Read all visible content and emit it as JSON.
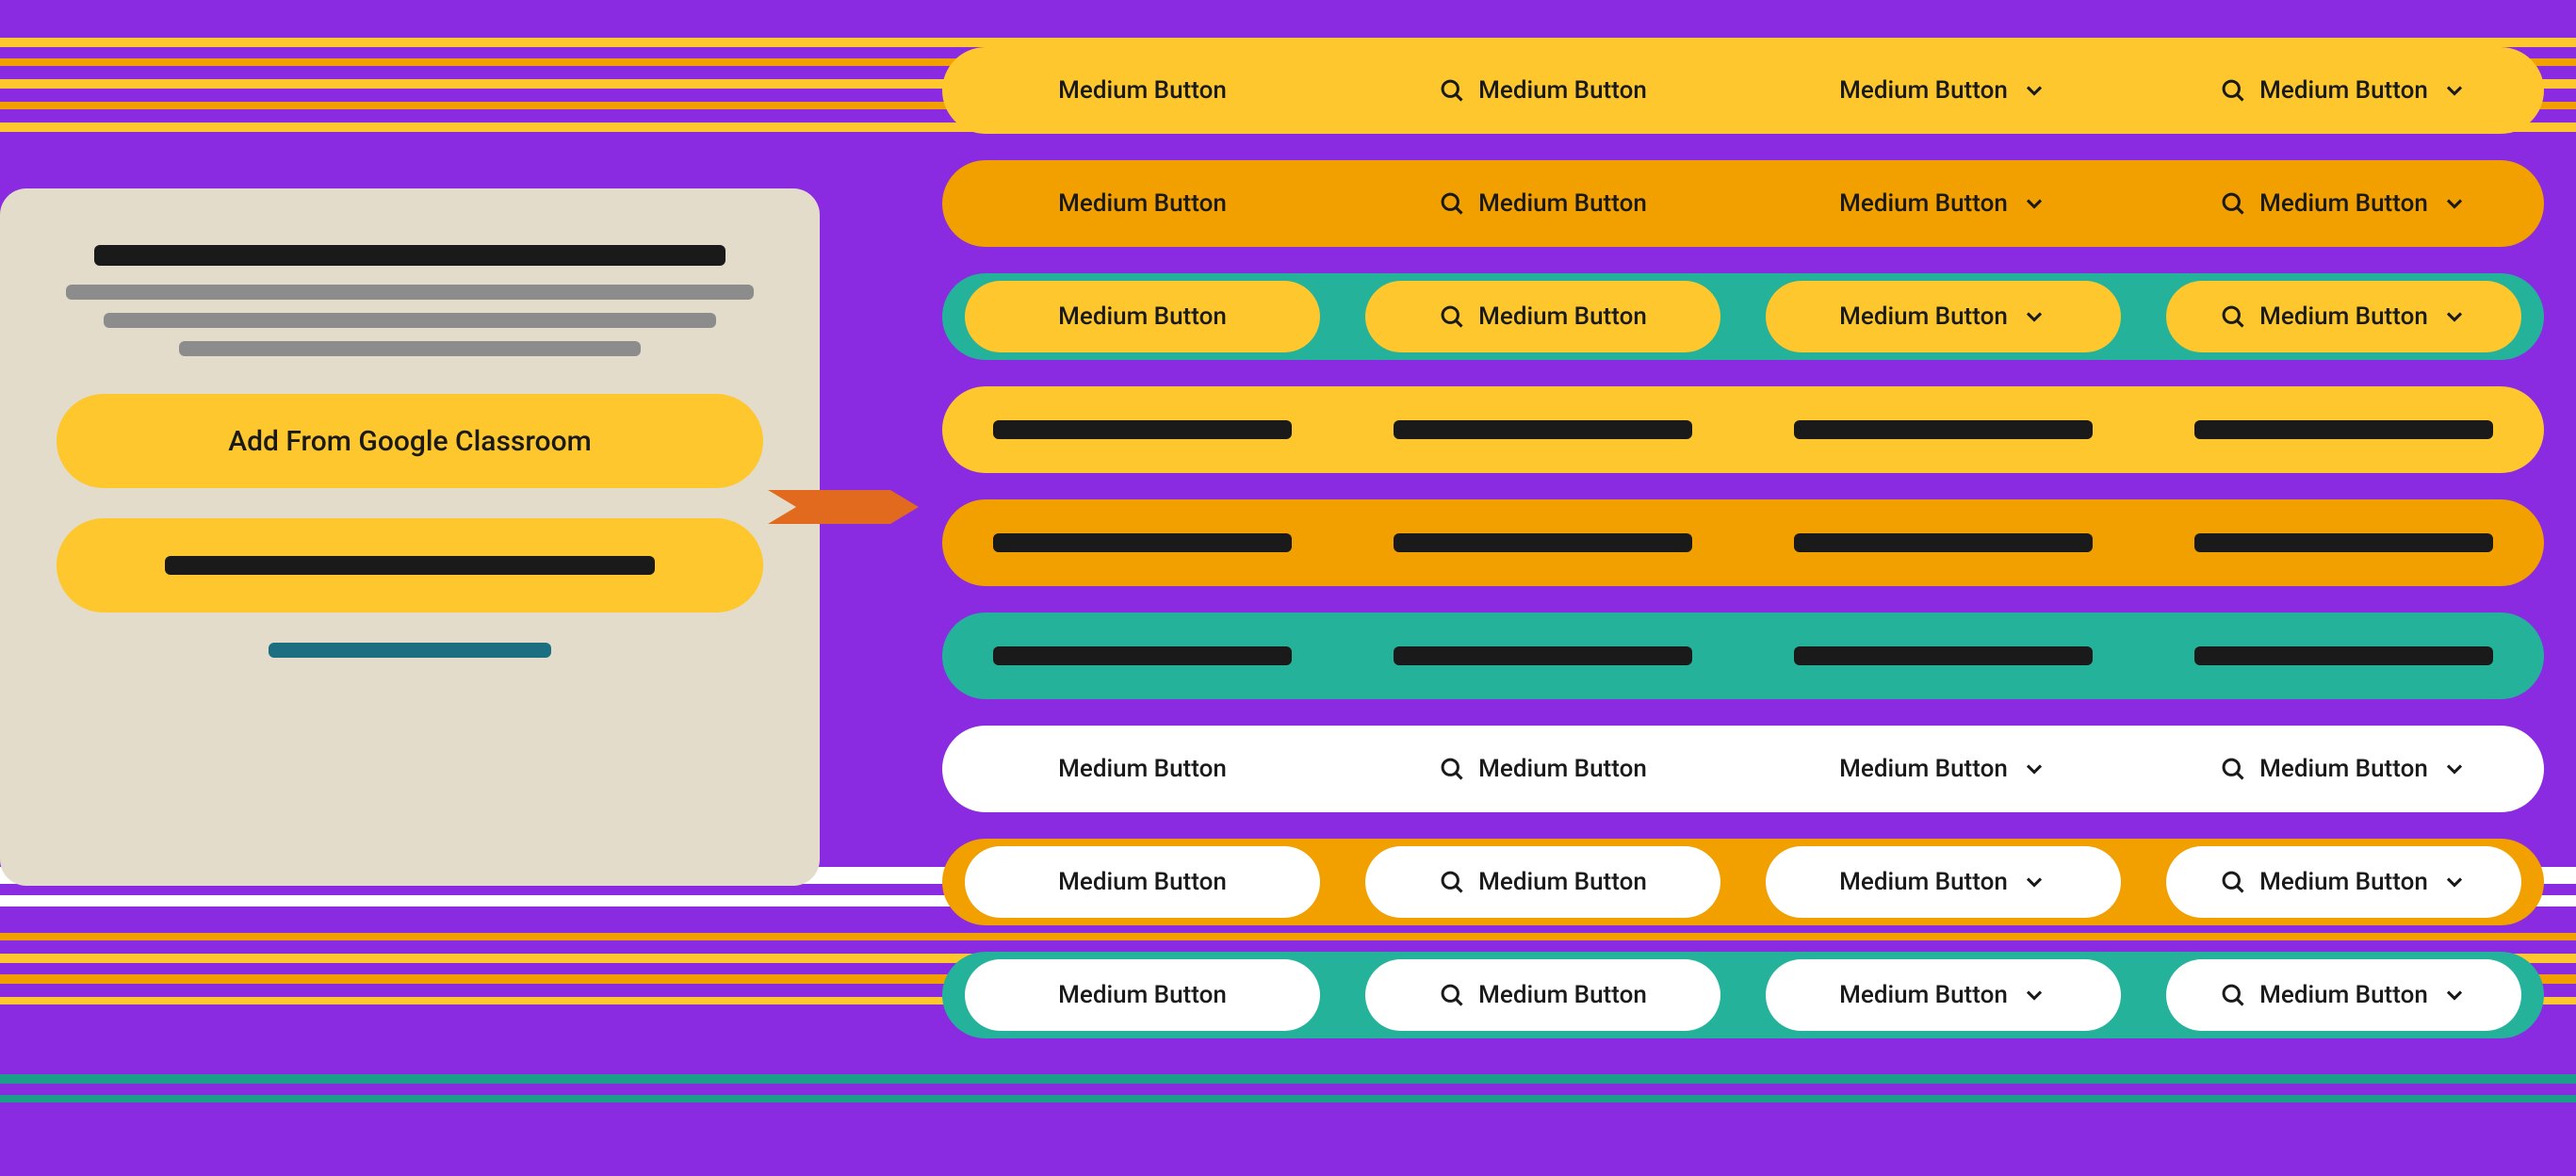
{
  "colors": {
    "yellow": "#fdc72d",
    "orange": "#f29f00",
    "teal": "#24b39a",
    "white": "#ffffff",
    "purple": "#8a2be2"
  },
  "card": {
    "button_primary": "Add From Google Classroom"
  },
  "button_label": "Medium Button",
  "rows": [
    {
      "variant": "yellow",
      "pill": false,
      "redacted": false
    },
    {
      "variant": "orange",
      "pill": false,
      "redacted": false
    },
    {
      "variant": "teal",
      "pill": "yellow",
      "redacted": false
    },
    {
      "variant": "yellow",
      "pill": false,
      "redacted": true
    },
    {
      "variant": "orange",
      "pill": false,
      "redacted": true
    },
    {
      "variant": "teal",
      "pill": false,
      "redacted": true
    },
    {
      "variant": "white",
      "pill": false,
      "redacted": false
    },
    {
      "variant": "orange",
      "pill": "white",
      "redacted": false
    },
    {
      "variant": "teal",
      "pill": "white",
      "redacted": false
    }
  ],
  "cells_per_row": [
    {
      "icons": []
    },
    {
      "icons": [
        "search"
      ]
    },
    {
      "icons": [
        "chevron"
      ]
    },
    {
      "icons": [
        "search",
        "chevron"
      ]
    }
  ]
}
